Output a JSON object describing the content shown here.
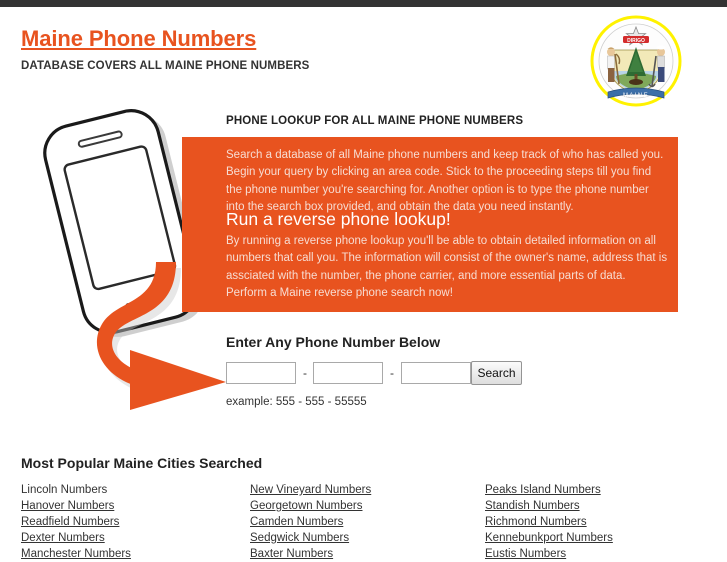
{
  "topbar": {
    "color": "#333333"
  },
  "header": {
    "title": "Maine Phone Numbers",
    "tagline": "DATABASE COVERS ALL MAINE PHONE NUMBERS",
    "seal_label": "maine-state-seal"
  },
  "hero": {
    "graphic_label": "phone-with-arrow-illustration",
    "lookup_heading": "PHONE LOOKUP FOR ALL MAINE PHONE NUMBERS"
  },
  "panel": {
    "accent_color": "#E8531F",
    "paragraph1": "Search a database of all Maine phone numbers and keep track of who has called you. Begin your query by clicking an area code. Stick to the proceeding steps till you find the phone number you're searching for. Another option is to type the phone number into the search box provided, and obtain the data you need instantly.",
    "subheading": "Run a reverse phone lookup!",
    "paragraph2": "By running a reverse phone lookup you'll be able to obtain detailed information on all numbers that call you. The information will consist of the owner's name, address that is assciated with the number, the phone carrier, and more essential parts of data. Perform a Maine reverse phone search now!"
  },
  "search": {
    "heading": "Enter Any Phone Number Below",
    "part1_value": "",
    "part2_value": "",
    "part3_value": "",
    "separator": "-",
    "button_label": "Search",
    "example": "example: 555 - 555 - 55555"
  },
  "cities": {
    "heading": "Most Popular Maine Cities Searched",
    "columns": [
      [
        {
          "label": "Lincoln Numbers",
          "underlined": false
        },
        {
          "label": "Hanover Numbers",
          "underlined": true
        },
        {
          "label": "Readfield Numbers",
          "underlined": true
        },
        {
          "label": "Dexter Numbers",
          "underlined": true
        },
        {
          "label": "Manchester Numbers",
          "underlined": true
        }
      ],
      [
        {
          "label": "New Vineyard Numbers",
          "underlined": true
        },
        {
          "label": "Georgetown Numbers",
          "underlined": true
        },
        {
          "label": "Camden Numbers",
          "underlined": true
        },
        {
          "label": "Sedgwick Numbers",
          "underlined": true
        },
        {
          "label": "Baxter Numbers",
          "underlined": true
        }
      ],
      [
        {
          "label": "Peaks Island Numbers",
          "underlined": true
        },
        {
          "label": "Standish Numbers",
          "underlined": true
        },
        {
          "label": "Richmond Numbers",
          "underlined": true
        },
        {
          "label": "Kennebunkport Numbers",
          "underlined": true
        },
        {
          "label": "Eustis Numbers",
          "underlined": true
        }
      ]
    ]
  }
}
